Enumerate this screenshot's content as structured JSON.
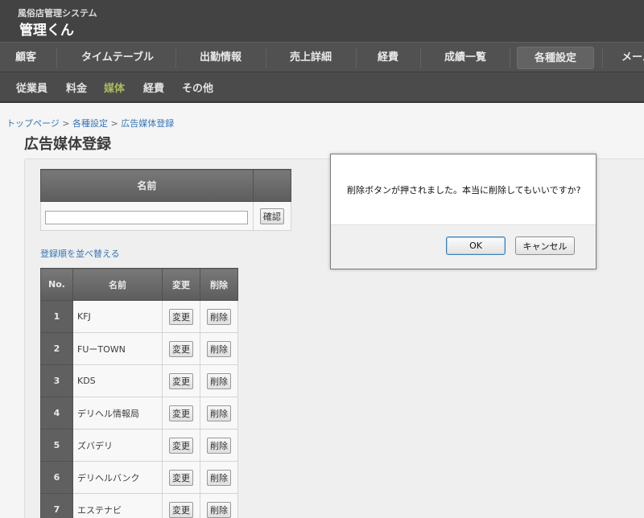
{
  "app": {
    "subtitle": "風俗店管理システム",
    "title": "管理くん"
  },
  "nav_main": [
    {
      "label": "顧客"
    },
    {
      "label": "タイムテーブル"
    },
    {
      "label": "出勤情報"
    },
    {
      "label": "売上詳細"
    },
    {
      "label": "経費"
    },
    {
      "label": "成績一覧"
    },
    {
      "label": "各種設定",
      "selected": true
    },
    {
      "label": "メール"
    }
  ],
  "nav_sub": [
    {
      "label": "従業員"
    },
    {
      "label": "料金"
    },
    {
      "label": "媒体",
      "selected": true
    },
    {
      "label": "経費"
    },
    {
      "label": "その他"
    }
  ],
  "breadcrumb": {
    "home": "トップページ",
    "parent": "各種設定",
    "current": "広告媒体登録",
    "sep": ">"
  },
  "page_title": "広告媒体登録",
  "register": {
    "name_header": "名前",
    "name_value": "",
    "confirm_label": "確認"
  },
  "reorder_link": "登録順を並べ替える",
  "list": {
    "headers": {
      "no": "No.",
      "name": "名前",
      "edit": "変更",
      "delete": "削除"
    },
    "edit_label": "変更",
    "delete_label": "削除",
    "rows": [
      {
        "no": "1",
        "name": "KFJ"
      },
      {
        "no": "2",
        "name": "FUーTOWN"
      },
      {
        "no": "3",
        "name": "KDS"
      },
      {
        "no": "4",
        "name": "デリヘル情報局"
      },
      {
        "no": "5",
        "name": "ズバデリ"
      },
      {
        "no": "6",
        "name": "デリヘルバンク"
      },
      {
        "no": "7",
        "name": "エステナビ"
      }
    ]
  },
  "dialog": {
    "message": "削除ボタンが押されました。本当に削除してもいいですか?",
    "ok_label": "OK",
    "cancel_label": "キャンセル"
  }
}
